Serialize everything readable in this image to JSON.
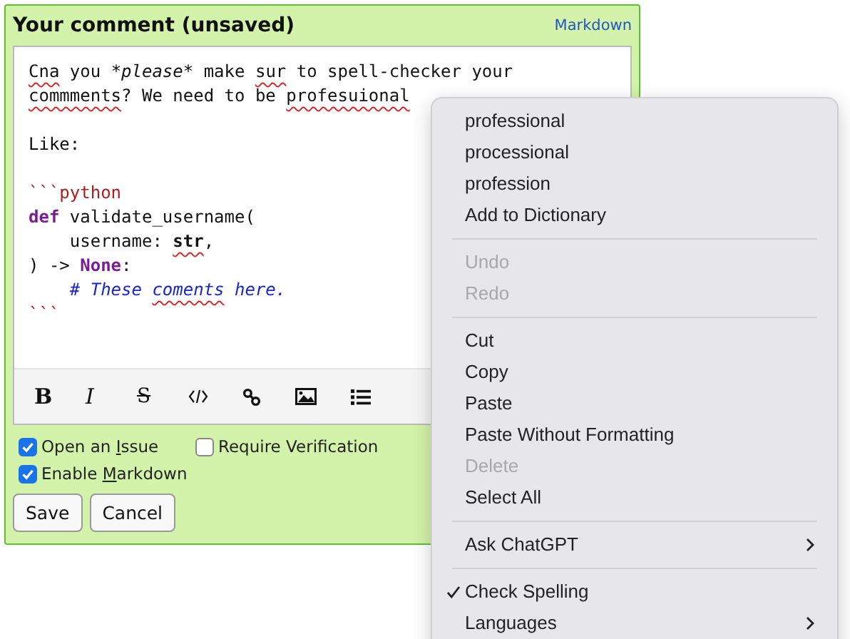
{
  "panel": {
    "title": "Your comment (unsaved)",
    "link": "Markdown"
  },
  "editor": {
    "lines": [
      {
        "kind": "text",
        "segments": [
          {
            "text": "Cna",
            "kind": "misspelled"
          },
          {
            "text": " you ",
            "kind": "plain"
          },
          {
            "text": "*please*",
            "kind": "emphasis"
          },
          {
            "text": " make ",
            "kind": "plain"
          },
          {
            "text": "sur",
            "kind": "misspelled"
          },
          {
            "text": " to spell-checker your",
            "kind": "plain"
          }
        ]
      },
      {
        "kind": "text",
        "segments": [
          {
            "text": "commments",
            "kind": "misspelled"
          },
          {
            "text": "? We need to be ",
            "kind": "plain"
          },
          {
            "text": "profesuional",
            "kind": "misspelled"
          }
        ]
      },
      {
        "kind": "blank"
      },
      {
        "kind": "text",
        "segments": [
          {
            "text": "Like:",
            "kind": "plain"
          }
        ]
      },
      {
        "kind": "blank"
      },
      {
        "kind": "text",
        "segments": [
          {
            "text": "```python",
            "kind": "fence"
          }
        ]
      },
      {
        "kind": "text",
        "segments": [
          {
            "text": "def",
            "kind": "keyword"
          },
          {
            "text": " validate_username(",
            "kind": "plain"
          }
        ]
      },
      {
        "kind": "text",
        "segments": [
          {
            "text": "    username: ",
            "kind": "plain"
          },
          {
            "text": "str",
            "kind": "type_misspelled"
          },
          {
            "text": ",",
            "kind": "plain"
          }
        ]
      },
      {
        "kind": "text",
        "segments": [
          {
            "text": ") -> ",
            "kind": "plain"
          },
          {
            "text": "None",
            "kind": "keyword"
          },
          {
            "text": ":",
            "kind": "plain"
          }
        ]
      },
      {
        "kind": "text",
        "segments": [
          {
            "text": "    # These ",
            "kind": "comment"
          },
          {
            "text": "coments",
            "kind": "comment_misspelled"
          },
          {
            "text": " here.",
            "kind": "comment"
          }
        ]
      },
      {
        "kind": "text",
        "segments": [
          {
            "text": "```",
            "kind": "fence"
          }
        ]
      }
    ]
  },
  "toolbar": [
    {
      "kind": "bold",
      "label": "B"
    },
    {
      "kind": "italic",
      "label": "I"
    },
    {
      "kind": "strike",
      "label": "S"
    },
    {
      "kind": "code"
    },
    {
      "kind": "link"
    },
    {
      "kind": "image"
    },
    {
      "kind": "list"
    }
  ],
  "options": [
    {
      "before": "Open an ",
      "key": "I",
      "after": "ssue",
      "checked": true
    },
    {
      "before": "Require Verification",
      "checked": false
    },
    {
      "before": "Enable ",
      "key": "M",
      "after": "arkdown",
      "checked": true
    }
  ],
  "buttons": [
    "Save",
    "Cancel"
  ],
  "context_menu": [
    [
      {
        "label": "professional",
        "disabled": false
      },
      {
        "label": "processional",
        "disabled": false
      },
      {
        "label": "profession",
        "disabled": false
      },
      {
        "label": "Add to Dictionary",
        "disabled": false
      }
    ],
    [
      {
        "label": "Undo",
        "disabled": true
      },
      {
        "label": "Redo",
        "disabled": true
      }
    ],
    [
      {
        "label": "Cut",
        "disabled": false
      },
      {
        "label": "Copy",
        "disabled": false
      },
      {
        "label": "Paste",
        "disabled": false
      },
      {
        "label": "Paste Without Formatting",
        "disabled": false
      },
      {
        "label": "Delete",
        "disabled": true
      },
      {
        "label": "Select All",
        "disabled": false
      }
    ],
    [
      {
        "label": "Ask ChatGPT",
        "disabled": false,
        "submenu": true
      }
    ],
    [
      {
        "label": "Check Spelling",
        "disabled": false,
        "checked": true
      },
      {
        "label": "Languages",
        "disabled": false,
        "submenu": true
      }
    ]
  ]
}
